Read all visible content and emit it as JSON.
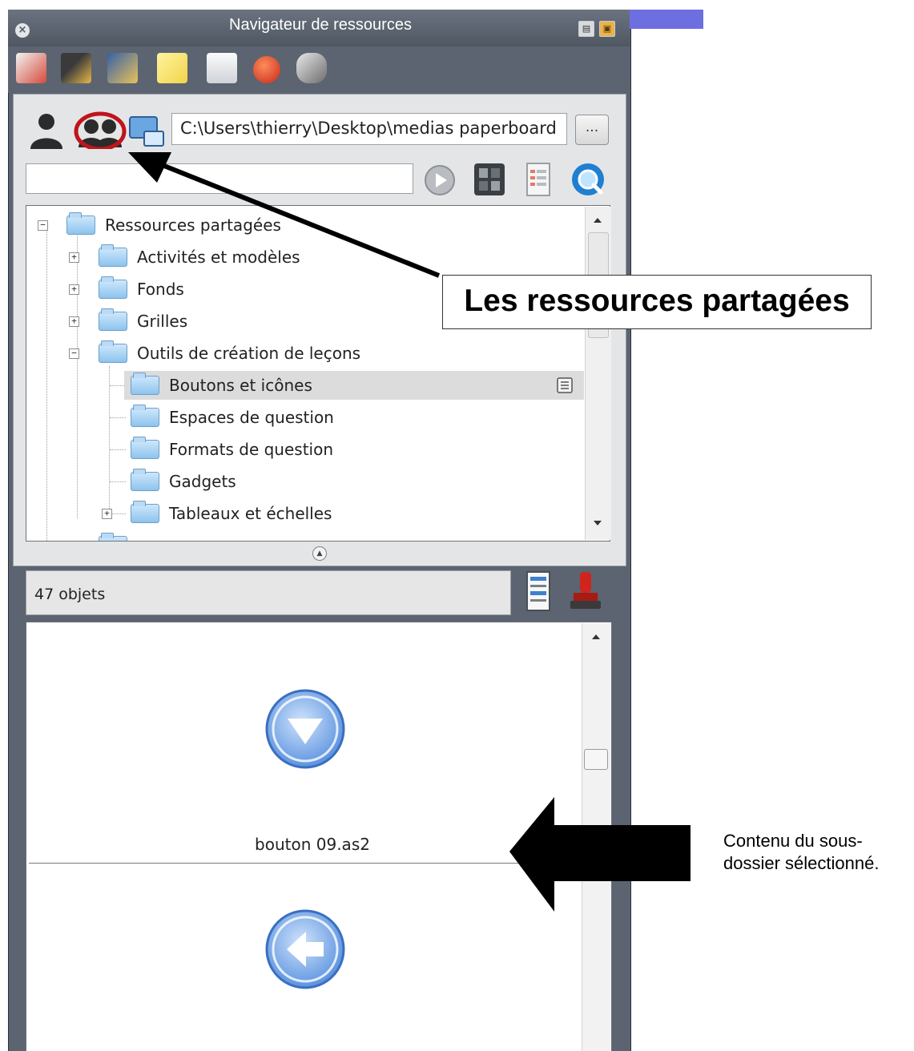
{
  "window": {
    "title": "Navigateur de ressources",
    "close_glyph": "×",
    "menu_glyph": "▤",
    "pin_glyph": "▣"
  },
  "category_icons": [
    "page-icon",
    "media-icon",
    "annotation-icon",
    "sticky-note-icon",
    "notes-page-icon",
    "spinning-top-icon",
    "mouse-icon"
  ],
  "source": {
    "path": "C:\\Users\\thierry\\Desktop\\medias paperboard",
    "browse_label": "...",
    "search_value": ""
  },
  "tree": {
    "items": [
      {
        "label": "Ressources partagées"
      },
      {
        "label": "Activités et modèles"
      },
      {
        "label": "Fonds"
      },
      {
        "label": "Grilles"
      },
      {
        "label": "Outils de création de leçons"
      },
      {
        "label": "Boutons et icônes"
      },
      {
        "label": "Espaces de question"
      },
      {
        "label": "Formats de question"
      },
      {
        "label": "Gadgets"
      },
      {
        "label": "Tableaux et échelles"
      }
    ],
    "expand_glyph": "+",
    "collapse_glyph": "−"
  },
  "status": {
    "count_text": "47 objets"
  },
  "content": {
    "items": [
      {
        "caption": "bouton 09.as2"
      }
    ]
  },
  "annotations": {
    "callout": "Les ressources partagées",
    "side_note": "Contenu du sous-dossier sélectionné."
  },
  "colors": {
    "panel": "#5b6470",
    "accent_purple": "#6d6fe0",
    "highlight_circle": "#c0141c",
    "folder_blue": "#8cc4ee",
    "button_blue": "#5b92e0"
  }
}
